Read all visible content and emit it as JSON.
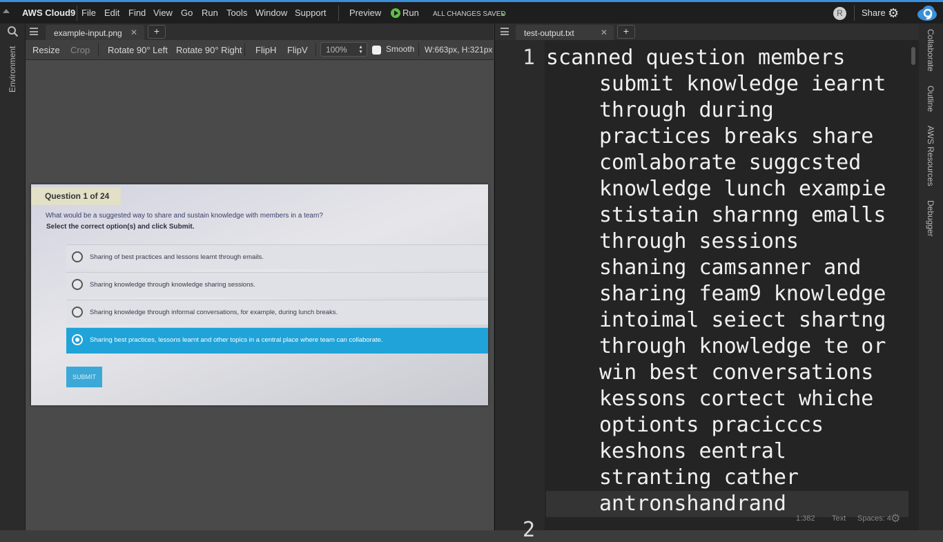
{
  "topbar": {
    "brand": "AWS Cloud9",
    "menu": [
      "File",
      "Edit",
      "Find",
      "View",
      "Go",
      "Run",
      "Tools",
      "Window",
      "Support"
    ],
    "preview": "Preview",
    "run": "Run",
    "status": "ALL CHANGES SAVED",
    "avatar_initial": "R",
    "share": "Share"
  },
  "left_sidebar": {
    "label": "Environment"
  },
  "right_sidebar": {
    "labels": [
      "Collaborate",
      "Outline",
      "AWS Resources",
      "Debugger"
    ]
  },
  "image_pane": {
    "tab": {
      "label": "example-input.png"
    },
    "toolbar": {
      "resize": "Resize",
      "crop": "Crop",
      "rotate_left": "Rotate 90° Left",
      "rotate_right": "Rotate 90° Right",
      "fliph": "FlipH",
      "flipv": "FlipV",
      "zoom": "100%",
      "smooth": "Smooth",
      "dimensions": "W:663px, H:321px"
    },
    "photo": {
      "heading": "Question 1 of 24",
      "question": "What would be a suggested way to share and sustain knowledge with members in a team?",
      "instruction": "Select the correct option(s) and click Submit.",
      "options": [
        "Sharing of best practices and lessons learnt through emails.",
        "Sharing knowledge through knowledge sharing sessions.",
        "Sharing knowledge through informal conversations, for example, during lunch breaks.",
        "Sharing best practices, lessons learnt and other topics in a central place where team can collaborate."
      ],
      "selected_option_index": 3,
      "submit": "SUBMIT"
    }
  },
  "text_pane": {
    "tab": {
      "label": "test-output.txt"
    },
    "line_numbers": [
      "1",
      "2"
    ],
    "lines": [
      "scanned question members",
      "submit knowledge iearnt",
      "through during",
      "practices breaks share",
      "comlaborate suggcsted",
      "knowledge lunch exampie",
      "stistain sharnng emalls",
      "through sessions",
      "shaning camsanner and",
      "sharing feam9 knowledge",
      "intoimal seiect shartng",
      "through knowledge te or",
      "win best conversations",
      "kessons cortect whiche",
      "optionts pracicccs",
      "keshons eentral",
      "stranting cather",
      "antronshandrand"
    ],
    "status": {
      "cursor": "1:382",
      "mode": "Text",
      "spaces": "Spaces: 4"
    }
  },
  "colors": {
    "accent_blue": "#1fa3d8",
    "run_green": "#5cc04a",
    "topbar_border": "#3b8fd9"
  }
}
